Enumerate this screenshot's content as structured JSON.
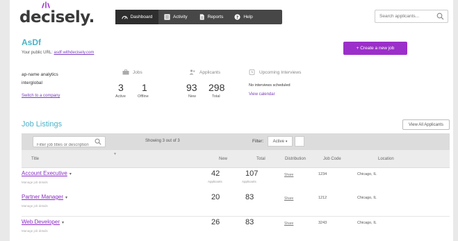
{
  "header": {
    "logo": "decisely.",
    "nav": [
      {
        "label": "Dashboard",
        "icon": "dashboard-icon",
        "active": true
      },
      {
        "label": "Activity",
        "icon": "activity-icon",
        "active": false
      },
      {
        "label": "Reports",
        "icon": "reports-icon",
        "active": false
      },
      {
        "label": "Help",
        "icon": "help-icon",
        "active": false
      }
    ],
    "search_placeholder": "Search applicants..."
  },
  "company": {
    "name": "AsDf",
    "public_url_label": "Your public URL:",
    "public_url": "asdf.withdecisely.com",
    "create_job_label": "+ Create a new job"
  },
  "account": {
    "name": "ap-name analytics",
    "sub": "interglobal",
    "switch_label": "Switch to a company"
  },
  "stats": {
    "jobs": {
      "label": "Jobs",
      "active": "3",
      "active_label": "Active",
      "offline": "1",
      "offline_label": "Offline"
    },
    "applicants": {
      "label": "Applicants",
      "new": "93",
      "new_label": "New",
      "total": "298",
      "total_label": "Total"
    },
    "interviews": {
      "label": "Upcoming Interviews",
      "empty": "No interviews scheduled",
      "calendar_link": "View calendar"
    }
  },
  "listings": {
    "title": "Job Listings",
    "view_all_label": "View All Applicants",
    "search_placeholder": "Filter job titles or description",
    "showing": "Showing 3 out of 3",
    "filter_label": "Filter:",
    "filter_value": "Active",
    "columns": [
      "Title",
      "New",
      "Total",
      "Distribution",
      "Job Code",
      "Location"
    ],
    "rows": [
      {
        "title": "Account Executive",
        "sub": "Manage job details",
        "new": "42",
        "new_sub": "Applicants",
        "total": "107",
        "total_sub": "Applicants",
        "distribution": "Share",
        "code": "1234",
        "location": "Chicago, IL"
      },
      {
        "title": "Partner Manager",
        "sub": "Manage job details",
        "new": "20",
        "new_sub": "",
        "total": "83",
        "total_sub": "",
        "distribution": "Share",
        "code": "1212",
        "location": "Chicago, IL"
      },
      {
        "title": "Web Developer",
        "sub": "Manage job details",
        "new": "26",
        "new_sub": "",
        "total": "83",
        "total_sub": "",
        "distribution": "Share",
        "code": "3243",
        "location": "Chicago, IL"
      }
    ]
  },
  "colors": {
    "accent": "#9b2fc9",
    "teal": "#4bb3c9",
    "nav_bg": "#474747"
  }
}
